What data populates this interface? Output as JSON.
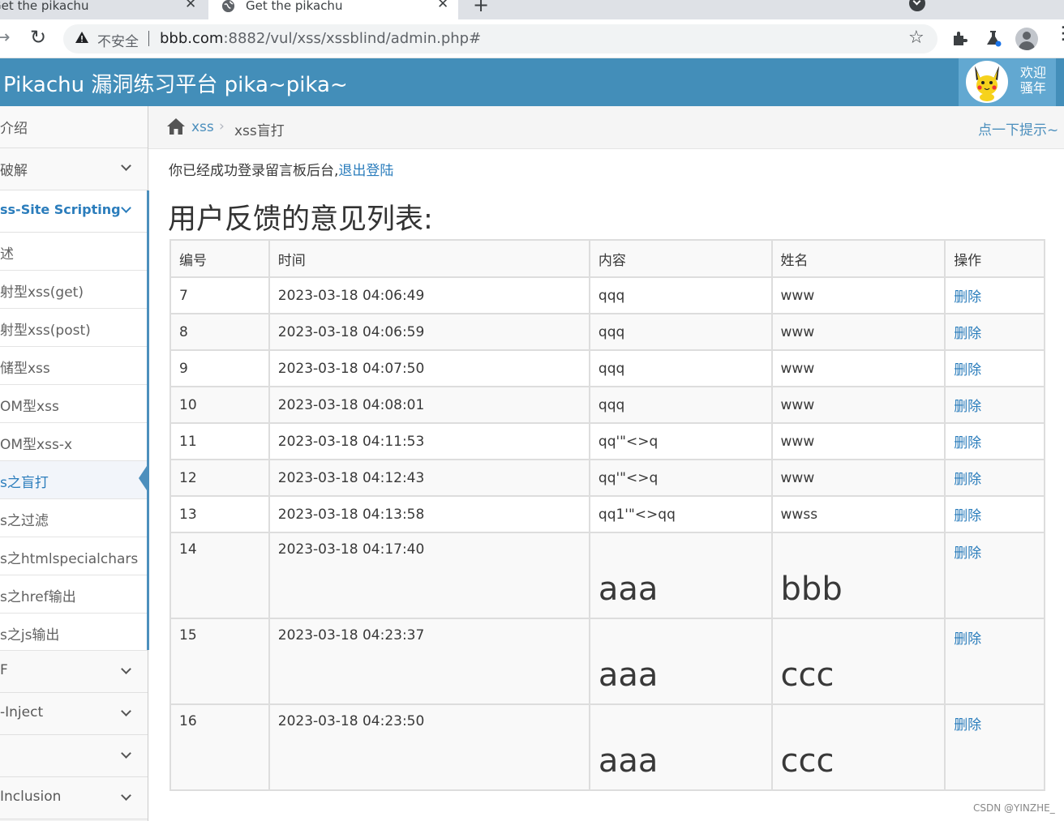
{
  "browser": {
    "tabs": [
      {
        "title": "Get the pikachu"
      },
      {
        "title": "Get the pikachu"
      }
    ],
    "security_label": "不安全",
    "url_host": "bbb.com",
    "url_rest": ":8882/vul/xss/xssblind/admin.php#"
  },
  "header": {
    "title": "Pikachu 漏洞练习平台 pika~pika~",
    "welcome_line1": "欢迎",
    "welcome_line2": "骚年"
  },
  "sidebar": {
    "items": [
      {
        "label": "介绍"
      },
      {
        "label": "破解"
      },
      {
        "label": "ss-Site Scripting"
      },
      {
        "label": "F"
      },
      {
        "label": "-Inject"
      },
      {
        "label": ""
      },
      {
        "label": "Inclusion"
      }
    ],
    "sub_items": [
      {
        "label": "述"
      },
      {
        "label": "射型xss(get)"
      },
      {
        "label": "射型xss(post)"
      },
      {
        "label": "储型xss"
      },
      {
        "label": "OM型xss"
      },
      {
        "label": "OM型xss-x"
      },
      {
        "label": "s之盲打"
      },
      {
        "label": "s之过滤"
      },
      {
        "label": "s之htmlspecialchars"
      },
      {
        "label": "s之href输出"
      },
      {
        "label": "s之js输出"
      }
    ]
  },
  "breadcrumb": {
    "parent": "xss",
    "separator": "›",
    "current": "xss盲打",
    "hint": "点一下提示~"
  },
  "content": {
    "message": "你已经成功登录留言板后台,",
    "logout_link": "退出登陆",
    "list_title": "用户反馈的意见列表:"
  },
  "table": {
    "headers": [
      "编号",
      "时间",
      "内容",
      "姓名",
      "操作"
    ],
    "rows": [
      {
        "id": "7",
        "time": "2023-03-18 04:06:49",
        "content": "qqq",
        "name": "www",
        "action": "删除"
      },
      {
        "id": "8",
        "time": "2023-03-18 04:06:59",
        "content": "qqq",
        "name": "www",
        "action": "删除"
      },
      {
        "id": "9",
        "time": "2023-03-18 04:07:50",
        "content": "qqq",
        "name": "www",
        "action": "删除"
      },
      {
        "id": "10",
        "time": "2023-03-18 04:08:01",
        "content": "qqq",
        "name": "www",
        "action": "删除"
      },
      {
        "id": "11",
        "time": "2023-03-18 04:11:53",
        "content": "qq'\"<>q",
        "name": "www",
        "action": "删除"
      },
      {
        "id": "12",
        "time": "2023-03-18 04:12:43",
        "content": "qq'\"<>q",
        "name": "www",
        "action": "删除"
      },
      {
        "id": "13",
        "time": "2023-03-18 04:13:58",
        "content": "qq1'\"<>qq",
        "name": "wwss",
        "action": "删除"
      },
      {
        "id": "14",
        "time": "2023-03-18 04:17:40",
        "content": "aaa",
        "name": "bbb",
        "action": "删除"
      },
      {
        "id": "15",
        "time": "2023-03-18 04:23:37",
        "content": "aaa",
        "name": "ccc",
        "action": "删除"
      },
      {
        "id": "16",
        "time": "2023-03-18 04:23:50",
        "content": "aaa",
        "name": "ccc",
        "action": "删除"
      }
    ]
  },
  "watermark": "CSDN @YINZHE_",
  "colors": {
    "header_bg": "#438eb9",
    "link": "#2b7dbc",
    "sidebar_active": "#4c8fbd"
  }
}
